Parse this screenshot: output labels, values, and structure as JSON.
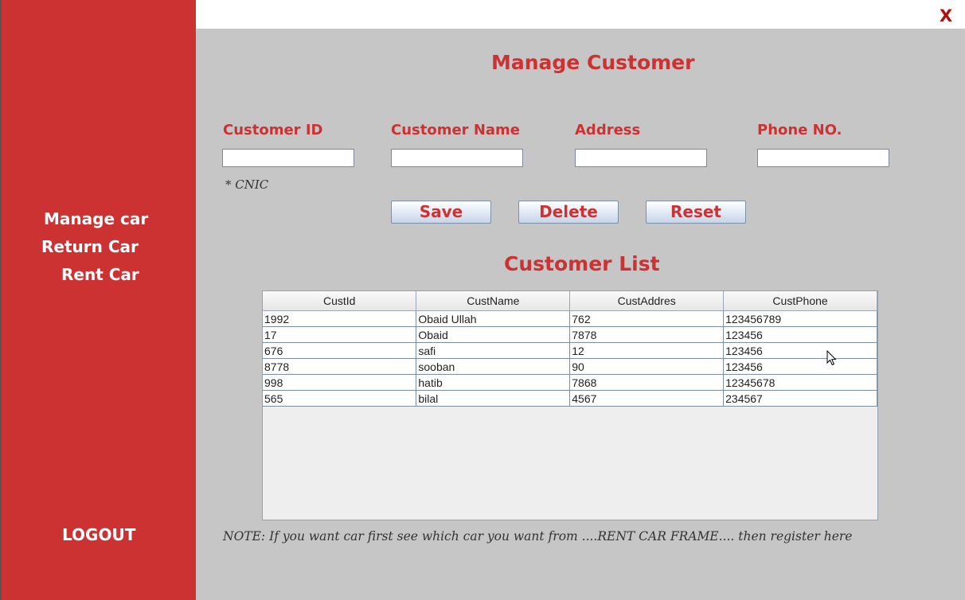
{
  "sidebar": {
    "items": [
      {
        "label": "Manage car"
      },
      {
        "label": "Return Car"
      },
      {
        "label": "Rent Car"
      }
    ],
    "logout_label": "LOGOUT"
  },
  "window": {
    "close_label": "X"
  },
  "form": {
    "title": "Manage Customer",
    "fields": [
      {
        "label": "Customer ID",
        "value": ""
      },
      {
        "label": "Customer Name",
        "value": ""
      },
      {
        "label": "Address",
        "value": ""
      },
      {
        "label": "Phone NO.",
        "value": ""
      }
    ],
    "id_hint": "* CNIC",
    "buttons": {
      "save": "Save",
      "delete": "Delete",
      "reset": "Reset"
    }
  },
  "list": {
    "title": "Customer List",
    "columns": [
      "CustId",
      "CustName",
      "CustAddres",
      "CustPhone"
    ],
    "rows": [
      [
        "1992",
        "Obaid Ullah",
        "762",
        "123456789"
      ],
      [
        "17",
        "Obaid",
        "7878",
        "123456"
      ],
      [
        "676",
        "safi",
        "12",
        "123456"
      ],
      [
        "8778",
        "sooban",
        "90",
        "123456"
      ],
      [
        "998",
        "hatib",
        "7868",
        "12345678"
      ],
      [
        "565",
        "bilal",
        "4567",
        "234567"
      ]
    ]
  },
  "note": "NOTE: If you want car first see which car you want from ....RENT CAR FRAME....  then register here",
  "colors": {
    "accent": "#cd3232",
    "background": "#c6c6c6",
    "sidebar": "#cd3232"
  }
}
